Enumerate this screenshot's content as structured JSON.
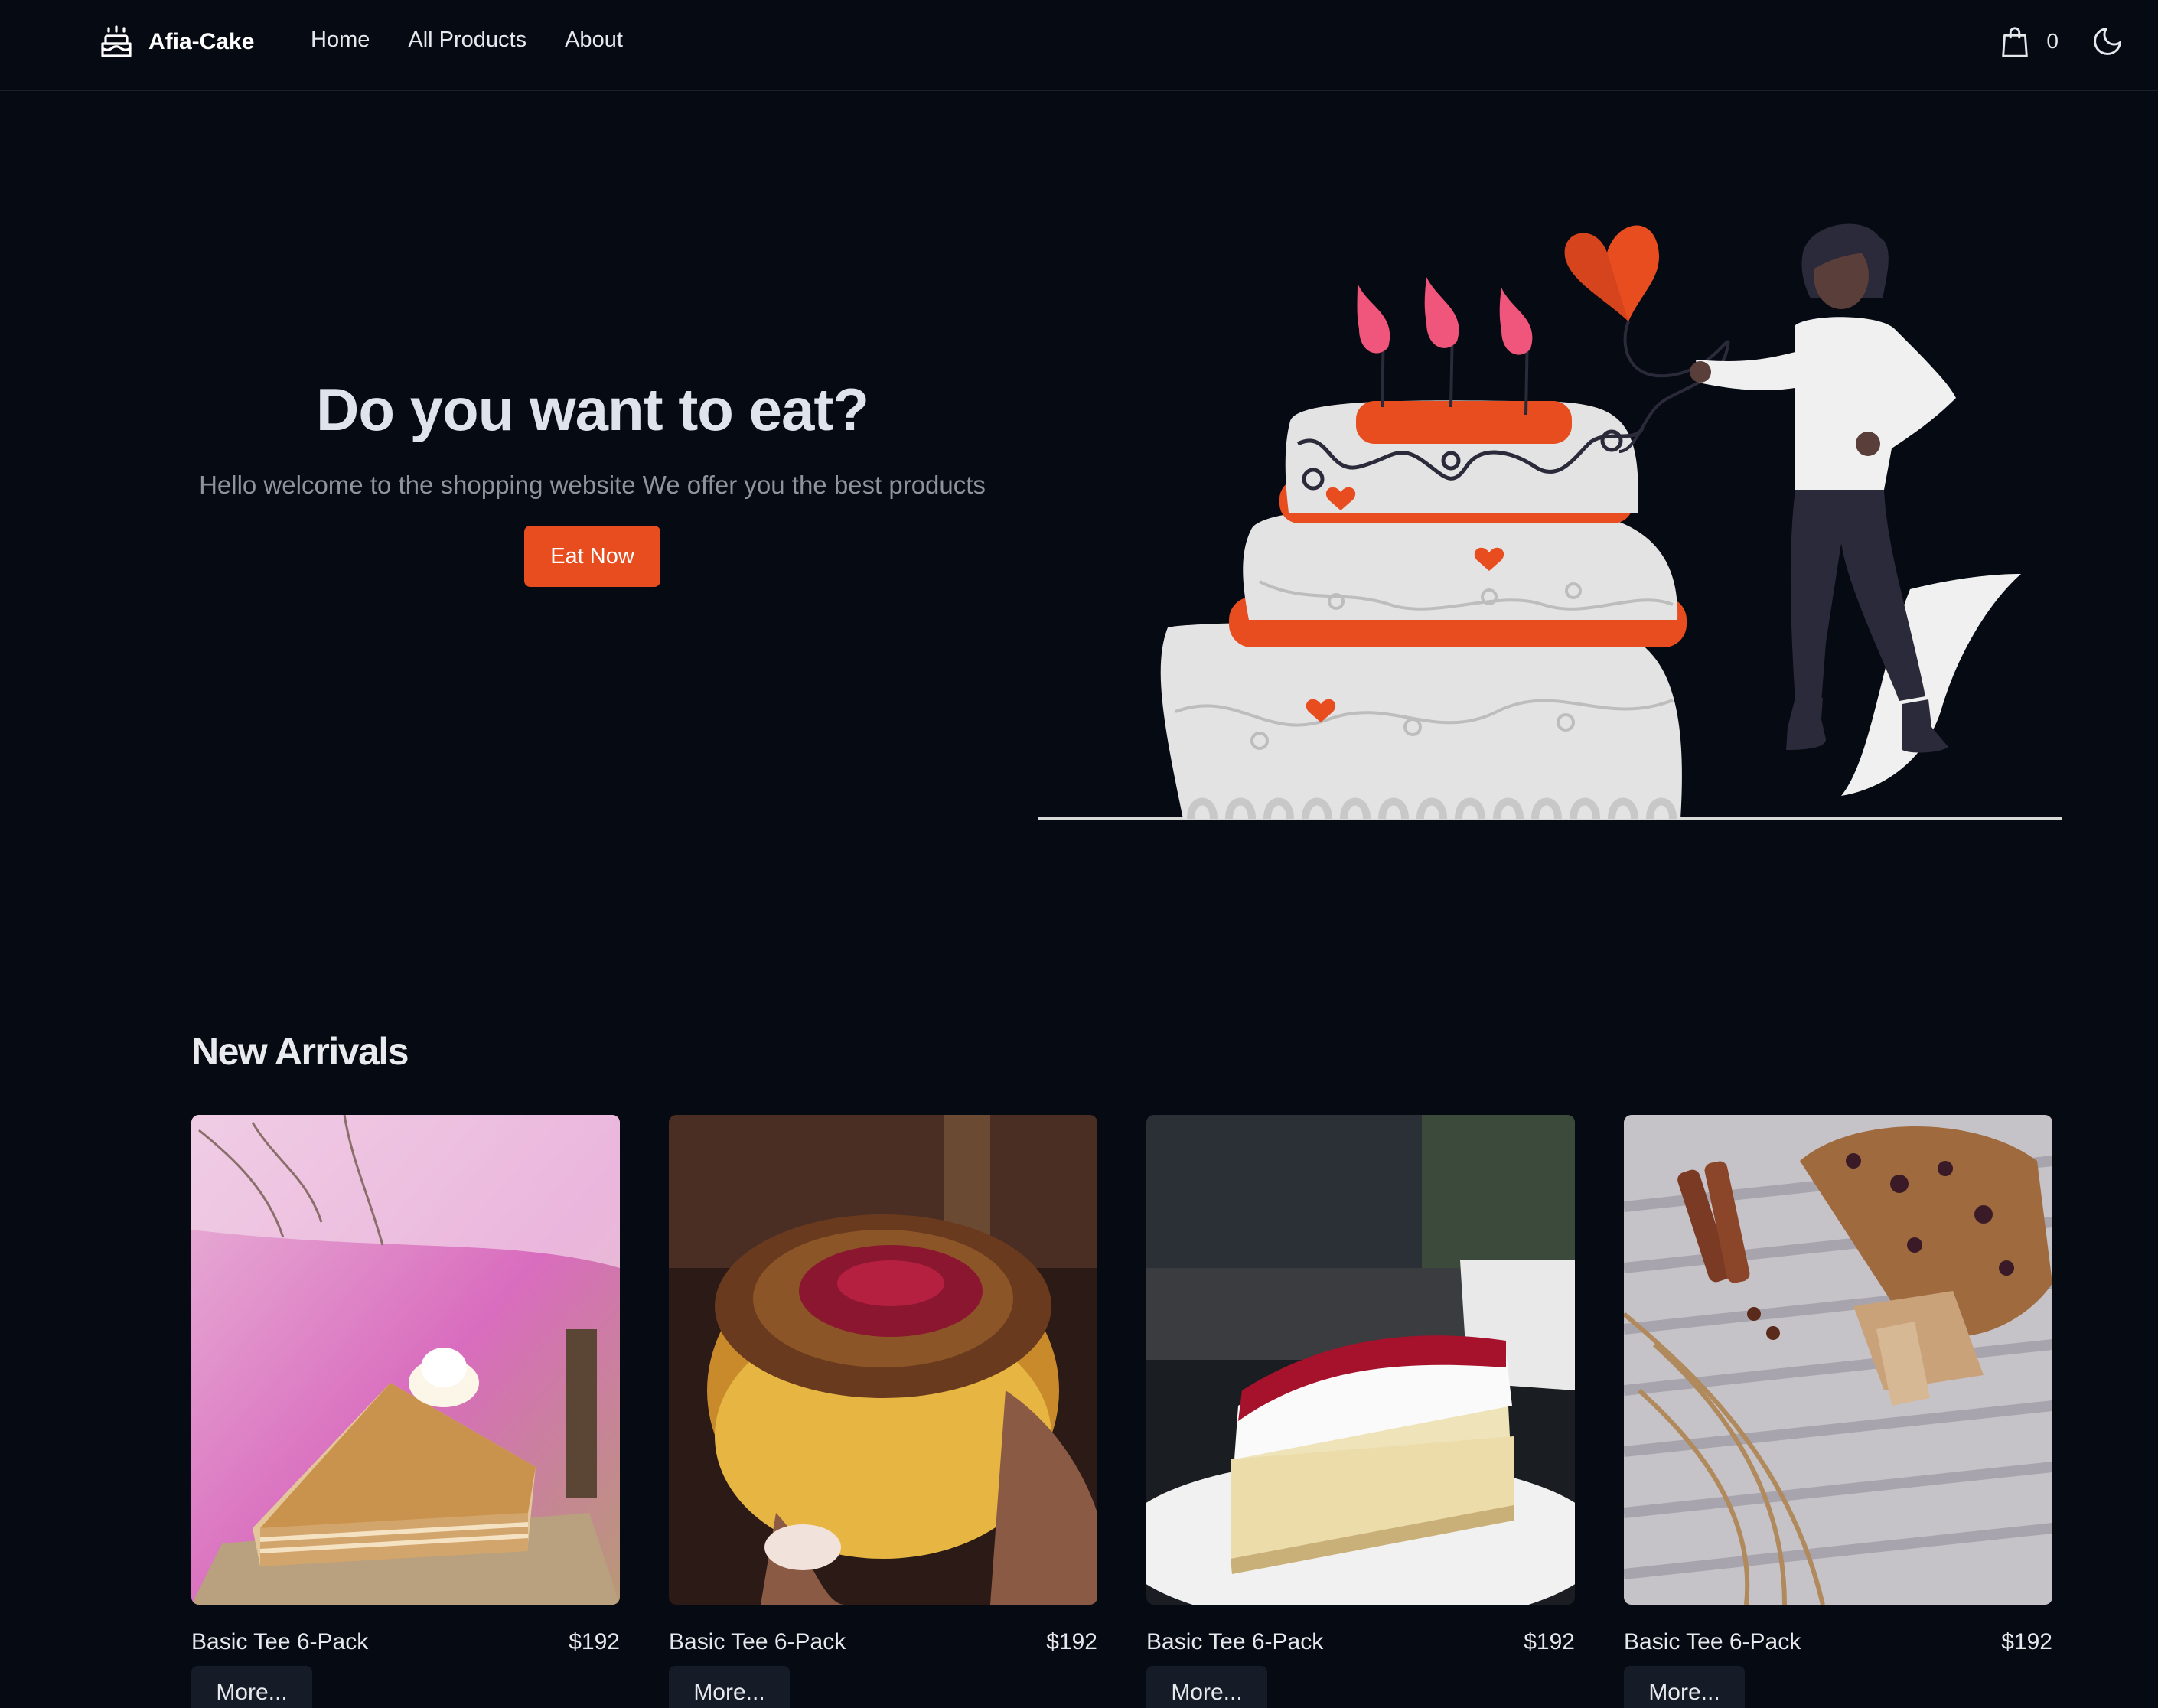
{
  "navbar": {
    "brand": "Afia-Cake",
    "links": [
      "Home",
      "All Products",
      "About"
    ],
    "cart_count": "0",
    "icons": {
      "brand": "cake-icon",
      "cart": "shopping-bag-icon",
      "theme": "moon-icon"
    }
  },
  "hero": {
    "title": "Do you want to eat?",
    "subtitle": "Hello welcome to the shopping website We offer you the best products",
    "cta": "Eat Now"
  },
  "new_arrivals": {
    "title": "New Arrivals",
    "products": [
      {
        "name": "Basic Tee 6-Pack",
        "price": "$192",
        "button": "More..."
      },
      {
        "name": "Basic Tee 6-Pack",
        "price": "$192",
        "button": "More..."
      },
      {
        "name": "Basic Tee 6-Pack",
        "price": "$192",
        "button": "More..."
      },
      {
        "name": "Basic Tee 6-Pack",
        "price": "$192",
        "button": "More..."
      }
    ]
  },
  "colors": {
    "background": "#060a12",
    "accent": "#e84d20",
    "card_button": "#151b27"
  }
}
